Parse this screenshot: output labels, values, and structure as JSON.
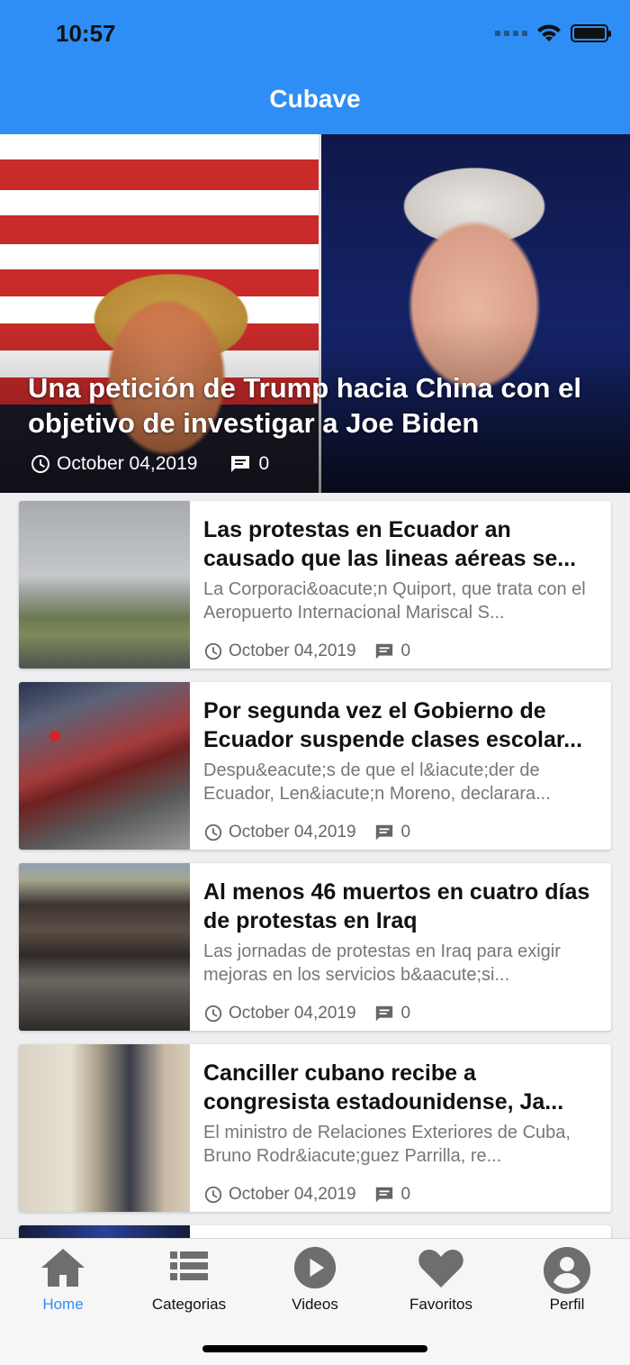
{
  "status_bar": {
    "time": "10:57"
  },
  "header": {
    "title": "Cubave"
  },
  "featured": {
    "title": "Una petición de Trump hacia China con el objetivo de investigar a Joe Biden",
    "date": "October 04,2019",
    "comments": "0"
  },
  "articles": [
    {
      "title": "Las protestas en Ecuador an causado que las lineas aéreas se...",
      "summary": "La Corporaci&oacute;n Quiport, que trata con el Aeropuerto Internacional Mariscal S...",
      "date": "October 04,2019",
      "comments": "0"
    },
    {
      "title": "Por segunda vez el Gobierno de Ecuador suspende clases escolar...",
      "summary": "Despu&eacute;s de que el l&iacute;der de Ecuador, Len&iacute;n Moreno, declarara...",
      "date": "October 04,2019",
      "comments": "0"
    },
    {
      "title": "Al menos 46 muertos en cuatro días de protestas en Iraq",
      "summary": "Las jornadas de protestas en Iraq para exigir mejoras en los servicios b&aacute;si...",
      "date": "October 04,2019",
      "comments": "0"
    },
    {
      "title": "Canciller cubano recibe a congresista estadounidense, Ja...",
      "summary": "El ministro de Relaciones Exteriores de Cuba, Bruno Rodr&iacute;guez Parrilla, re...",
      "date": "October 04,2019",
      "comments": "0"
    }
  ],
  "tabbar": {
    "items": [
      {
        "label": "Home",
        "icon": "home-icon"
      },
      {
        "label": "Categorias",
        "icon": "list-icon"
      },
      {
        "label": "Videos",
        "icon": "play-icon"
      },
      {
        "label": "Favoritos",
        "icon": "heart-icon"
      },
      {
        "label": "Perfil",
        "icon": "user-icon"
      }
    ],
    "active_color": "#2f8ef5"
  },
  "colors": {
    "accent": "#2f8ef5"
  }
}
